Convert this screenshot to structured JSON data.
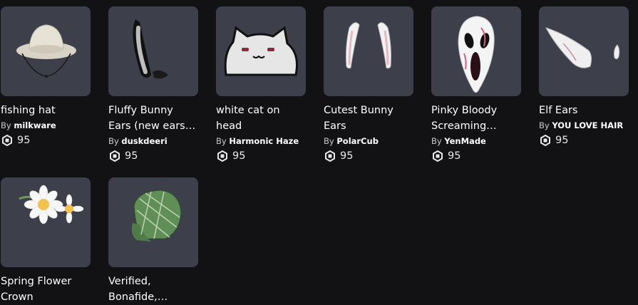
{
  "items": [
    {
      "name": "fishing hat",
      "by": "By",
      "creator": "milkware",
      "price": "95",
      "thumb": "fishing-hat"
    },
    {
      "name": "Fluffy Bunny Ears (new ears…",
      "by": "By",
      "creator": "duskdeeri",
      "price": "95",
      "thumb": "fluffy-bunny-ears"
    },
    {
      "name": "white cat on head",
      "by": "By",
      "creator": "Harmonic Haze",
      "price": "95",
      "thumb": "white-cat"
    },
    {
      "name": "Cutest Bunny Ears",
      "by": "By",
      "creator": "PolarCub",
      "price": "95",
      "thumb": "cutest-bunny-ears"
    },
    {
      "name": "Pinky Bloody Screaming…",
      "by": "By",
      "creator": "YenMade",
      "price": "95",
      "thumb": "ghost-mask"
    },
    {
      "name": "Elf Ears",
      "by": "By",
      "creator": "YOU LOVE HAIR",
      "price": "95",
      "thumb": "elf-ears"
    },
    {
      "name": "Spring Flower Crown",
      "by": "",
      "creator": "",
      "price": "",
      "thumb": "flower-crown"
    },
    {
      "name": "Verified, Bonafide,…",
      "by": "",
      "creator": "",
      "price": "",
      "thumb": "green-cap"
    }
  ],
  "colors": {
    "background": "#121215",
    "thumb_bg": "#3d3f4a",
    "text": "#ffffff",
    "muted": "#c9cacd"
  }
}
